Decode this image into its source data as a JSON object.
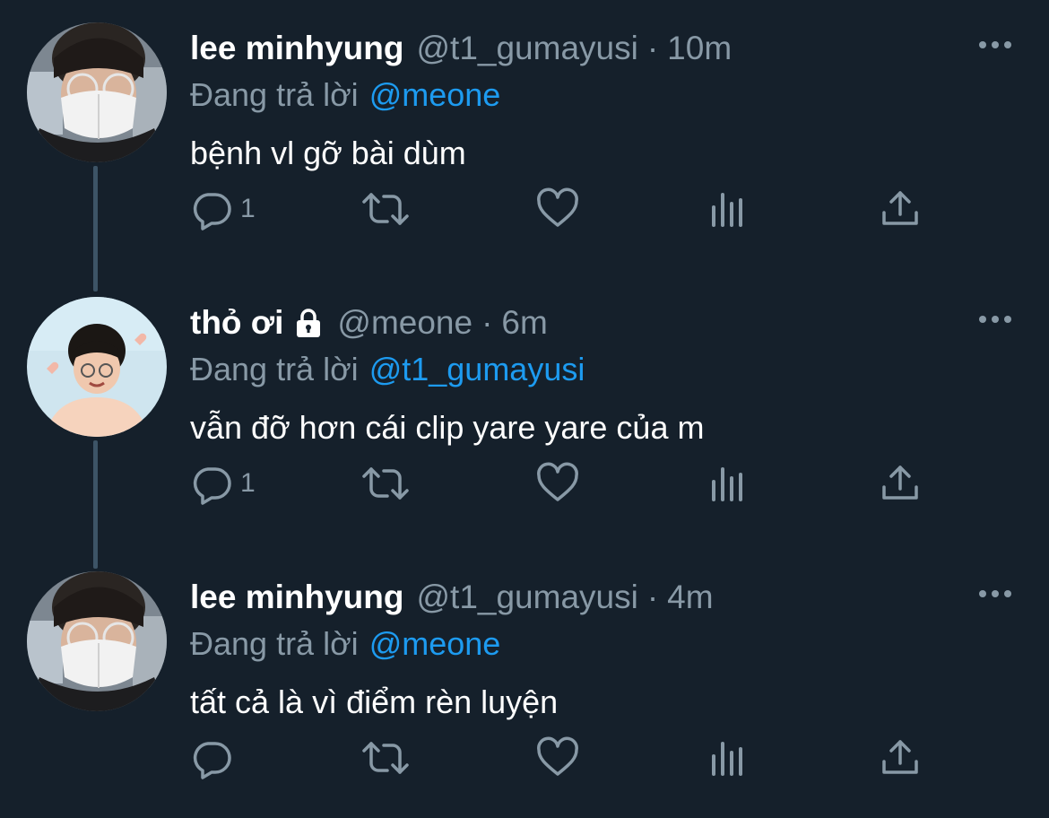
{
  "colors": {
    "background": "#15202b",
    "primary_text": "#ffffff",
    "secondary_text": "#8899a6",
    "link": "#1d9bf0",
    "thread_line": "#3d5466"
  },
  "tweets": [
    {
      "display_name": "lee minhyung",
      "handle": "@t1_gumayusi",
      "separator": "·",
      "time": "10m",
      "protected": false,
      "reply_prefix": "Đang trả lời",
      "reply_to": "@meone",
      "text": "bệnh vl gỡ bài dùm",
      "reply_count": "1",
      "icons": [
        "reply-icon",
        "retweet-icon",
        "like-icon",
        "analytics-icon",
        "share-icon",
        "more-icon"
      ]
    },
    {
      "display_name": "thỏ ơi",
      "handle": "@meone",
      "separator": "·",
      "time": "6m",
      "protected": true,
      "reply_prefix": "Đang trả lời",
      "reply_to": "@t1_gumayusi",
      "text": "vẫn đỡ hơn cái clip yare yare của m",
      "reply_count": "1",
      "icons": [
        "lock-icon",
        "reply-icon",
        "retweet-icon",
        "like-icon",
        "analytics-icon",
        "share-icon",
        "more-icon"
      ]
    },
    {
      "display_name": "lee minhyung",
      "handle": "@t1_gumayusi",
      "separator": "·",
      "time": "4m",
      "protected": false,
      "reply_prefix": "Đang trả lời",
      "reply_to": "@meone",
      "text": "tất cả là vì điểm rèn luyện",
      "reply_count": "",
      "icons": [
        "reply-icon",
        "retweet-icon",
        "like-icon",
        "analytics-icon",
        "share-icon",
        "more-icon"
      ]
    }
  ]
}
